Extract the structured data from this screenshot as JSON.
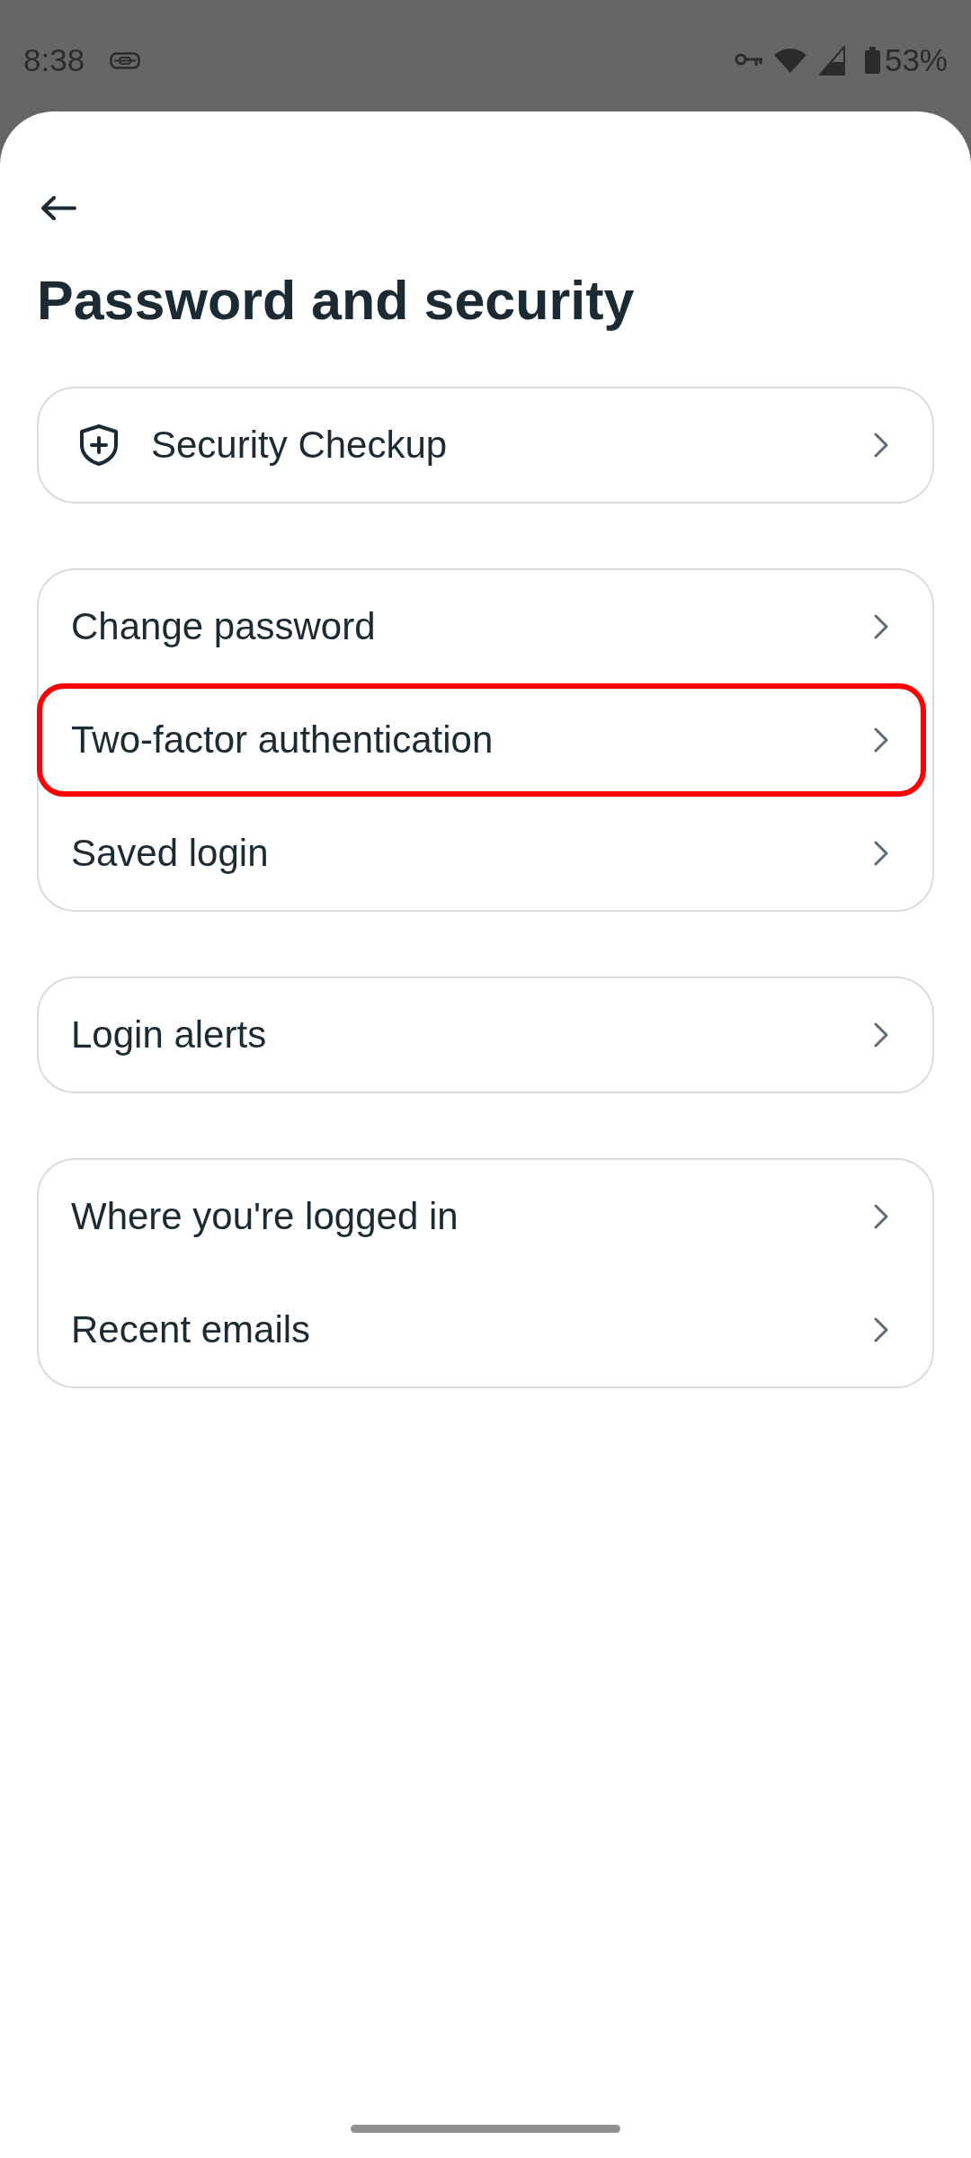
{
  "status_bar": {
    "time": "8:38",
    "battery": "53%"
  },
  "header": {
    "title": "Password and security"
  },
  "sections": [
    {
      "items": [
        {
          "label": "Security Checkup",
          "kind": "icon",
          "highlighted": false
        }
      ]
    },
    {
      "items": [
        {
          "label": "Change password",
          "kind": "plain",
          "highlighted": false
        },
        {
          "label": "Two-factor authentication",
          "kind": "plain",
          "highlighted": true
        },
        {
          "label": "Saved login",
          "kind": "plain",
          "highlighted": false
        }
      ]
    },
    {
      "items": [
        {
          "label": "Login alerts",
          "kind": "plain",
          "highlighted": false
        }
      ]
    },
    {
      "items": [
        {
          "label": "Where you're logged in",
          "kind": "plain",
          "highlighted": false
        },
        {
          "label": "Recent emails",
          "kind": "plain",
          "highlighted": false
        }
      ]
    }
  ]
}
